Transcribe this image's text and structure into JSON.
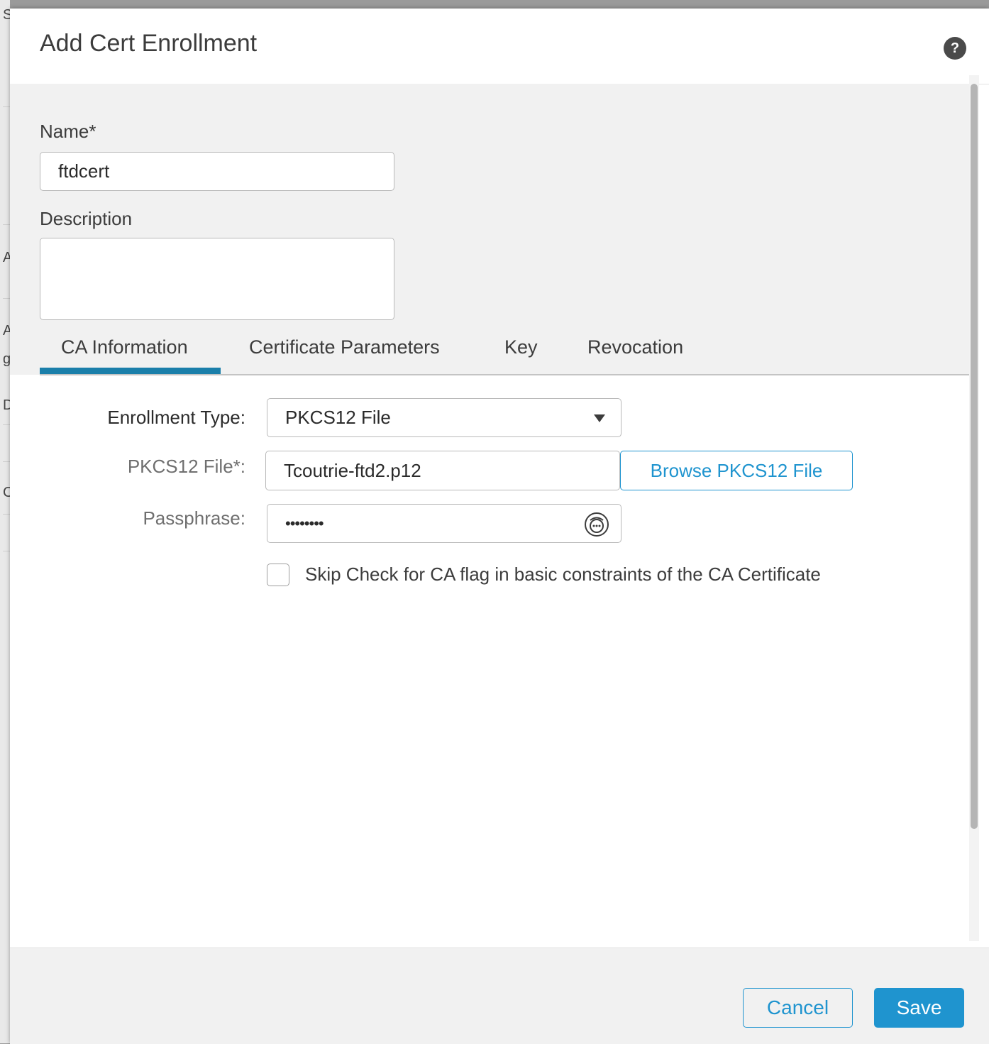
{
  "backdrop": {
    "chars": [
      "S",
      "A",
      "A",
      "g",
      "D",
      "C"
    ]
  },
  "dialog": {
    "title": "Add Cert Enrollment",
    "help_glyph": "?",
    "name_label": "Name*",
    "name_value": "ftdcert",
    "description_label": "Description",
    "description_value": "",
    "tabs": [
      {
        "label": "CA Information",
        "active": true
      },
      {
        "label": "Certificate Parameters",
        "active": false
      },
      {
        "label": "Key",
        "active": false
      },
      {
        "label": "Revocation",
        "active": false
      }
    ],
    "ca_info": {
      "enrollment_type_label": "Enrollment Type:",
      "enrollment_type_value": "PKCS12 File",
      "pkcs12_file_label": "PKCS12 File*:",
      "pkcs12_file_value": "Tcoutrie-ftd2.p12",
      "browse_label": "Browse PKCS12 File",
      "passphrase_label": "Passphrase:",
      "passphrase_value": "••••••••",
      "skip_check_label": "Skip Check for CA flag in basic constraints of the CA Certificate",
      "skip_check_checked": false
    },
    "footer": {
      "cancel_label": "Cancel",
      "save_label": "Save"
    }
  },
  "colors": {
    "accent": "#1f94cf",
    "tab_underline": "#1b7faa",
    "help_icon": "#4a4a4a"
  },
  "icons": {
    "help": "help-icon",
    "reveal_password": "eye-icon",
    "dropdown": "chevron-down-icon"
  }
}
